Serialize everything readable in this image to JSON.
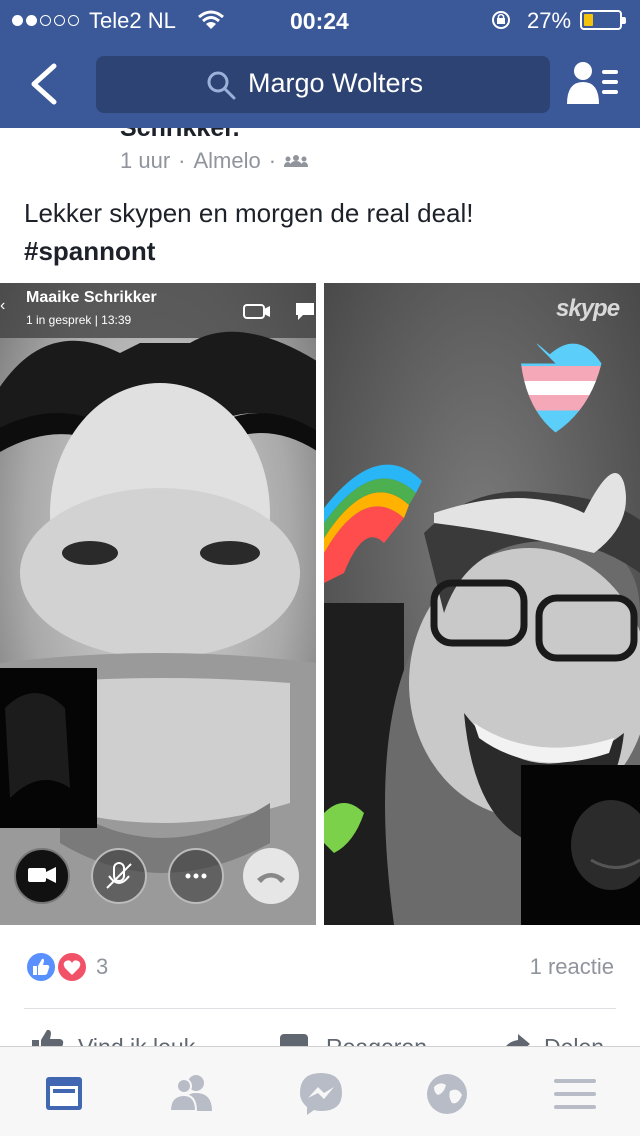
{
  "status_bar": {
    "carrier": "Tele2 NL",
    "time": "00:24",
    "battery_percent": "27%",
    "battery_level": 0.27,
    "signal_bars_filled": 2,
    "signal_bars_total": 5
  },
  "nav": {
    "search_text": "Margo Wolters",
    "back_icon": "chevron-left-icon",
    "right_icon": "friend-list-icon"
  },
  "post": {
    "author_partial": "Schrikker.",
    "time": "1 uur",
    "separator": "·",
    "location": "Almelo",
    "audience_icon": "friends-icon",
    "text_line1": "Lekker skypen en morgen de real deal!",
    "hashtag": "#spannont",
    "photo1": {
      "caller_name": "Maaike Schrikker",
      "call_status": "1 in gesprek | 13:39"
    },
    "photo2": {
      "watermark": "skype"
    },
    "reactions_count": "3",
    "comments_label": "1 reactie",
    "actions": {
      "like": "Vind ik leuk",
      "comment": "Reageren",
      "share": "Delen"
    }
  },
  "tabs": [
    "news-feed-icon",
    "friends-icon",
    "messenger-icon",
    "globe-icon",
    "menu-icon"
  ],
  "colors": {
    "brand": "#3b5998",
    "search_bg": "#2d4373",
    "like_blue": "#5890ff",
    "love_red": "#f25268",
    "battery_yellow": "#f4c20d",
    "active_tab": "#4267b2",
    "inactive_tab": "#b7bcc6"
  }
}
